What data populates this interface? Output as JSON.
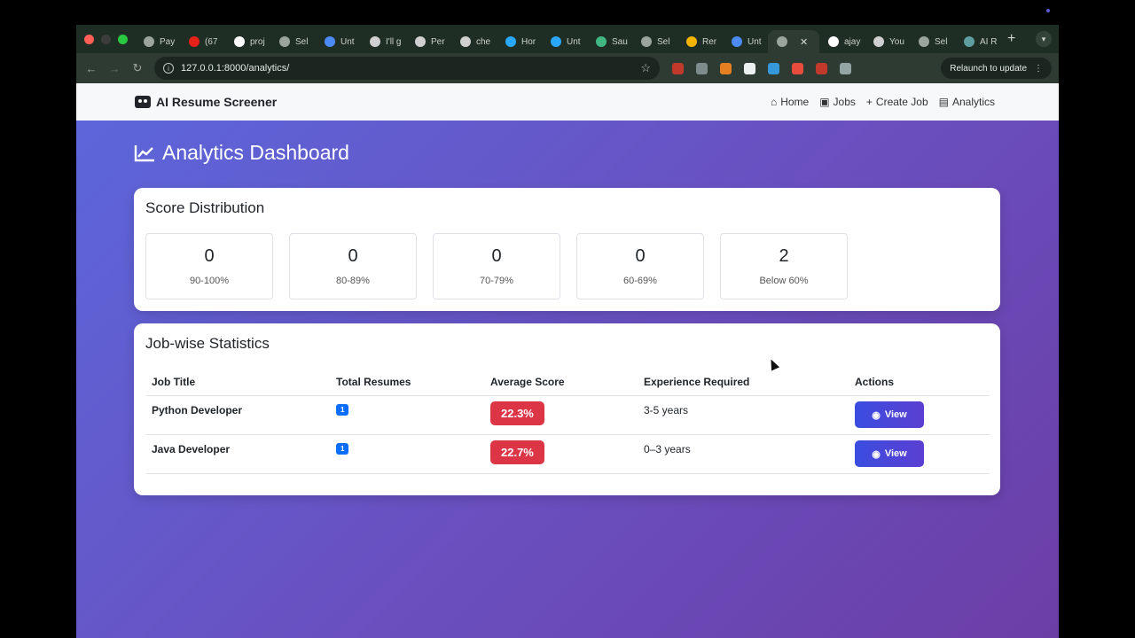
{
  "browser": {
    "tabs": [
      {
        "label": "Pay",
        "icon": "globe-icon",
        "color": "#9aa59d"
      },
      {
        "label": "(67",
        "icon": "youtube-icon",
        "color": "#e62117"
      },
      {
        "label": "proj",
        "icon": "github-icon",
        "color": "#ffffff"
      },
      {
        "label": "Sel",
        "icon": "globe-icon",
        "color": "#9aa59d"
      },
      {
        "label": "Unt",
        "icon": "docs-icon",
        "color": "#4c8bf5"
      },
      {
        "label": "I'll g",
        "icon": "openai-icon",
        "color": "#d0d0d0"
      },
      {
        "label": "Per",
        "icon": "openai-icon",
        "color": "#d0d0d0"
      },
      {
        "label": "che",
        "icon": "openai-icon",
        "color": "#d0d0d0"
      },
      {
        "label": "Hor",
        "icon": "copilot-icon",
        "color": "#2aa7ff"
      },
      {
        "label": "Unt",
        "icon": "copilot-icon",
        "color": "#2aa7ff"
      },
      {
        "label": "Sau",
        "icon": "vue-icon",
        "color": "#41b883"
      },
      {
        "label": "Sel",
        "icon": "globe-icon",
        "color": "#9aa59d"
      },
      {
        "label": "Rer",
        "icon": "slides-icon",
        "color": "#f4b400"
      },
      {
        "label": "Unt",
        "icon": "docs-icon",
        "color": "#4c8bf5"
      },
      {
        "label": "",
        "icon": "globe-icon",
        "color": "#9aa59d",
        "active": true
      },
      {
        "label": "ajay",
        "icon": "github-icon",
        "color": "#ffffff"
      },
      {
        "label": "You",
        "icon": "openai-icon",
        "color": "#d0d0d0"
      },
      {
        "label": "Sel",
        "icon": "globe-icon",
        "color": "#9aa59d"
      },
      {
        "label": "AI R",
        "icon": "globe-icon",
        "color": "#5f9ea0"
      }
    ],
    "url": "127.0.0.1:8000/analytics/",
    "relaunch_label": "Relaunch to update",
    "extensions": [
      "#c0392b",
      "#7f8c8d",
      "#e67e22",
      "#ecf0f1",
      "#3498db",
      "#e74c3c",
      "#c0392b",
      "#95a5a6"
    ]
  },
  "navbar": {
    "brand": "AI Resume Screener",
    "links": [
      {
        "label": "Home",
        "icon": "home-icon"
      },
      {
        "label": "Jobs",
        "icon": "briefcase-icon"
      },
      {
        "label": "Create Job",
        "icon": "plus-icon"
      },
      {
        "label": "Analytics",
        "icon": "chart-bar-icon"
      }
    ]
  },
  "page": {
    "title": "Analytics Dashboard"
  },
  "score_distribution": {
    "title": "Score Distribution",
    "buckets": [
      {
        "count": "0",
        "label": "90-100%"
      },
      {
        "count": "0",
        "label": "80-89%"
      },
      {
        "count": "0",
        "label": "70-79%"
      },
      {
        "count": "0",
        "label": "60-69%"
      },
      {
        "count": "2",
        "label": "Below 60%"
      }
    ]
  },
  "job_stats": {
    "title": "Job-wise Statistics",
    "headers": [
      "Job Title",
      "Total Resumes",
      "Average Score",
      "Experience Required",
      "Actions"
    ],
    "rows": [
      {
        "title": "Python Developer",
        "total": "1",
        "avg": "22.3%",
        "experience": "3-5 years",
        "action": "View"
      },
      {
        "title": "Java Developer",
        "total": "1",
        "avg": "22.7%",
        "experience": "0–3 years",
        "action": "View"
      }
    ]
  },
  "colors": {
    "score_badge": "#dc3545",
    "count_badge": "#0d6efd",
    "gradient_start": "#5b67db",
    "gradient_end": "#6b3ea6"
  }
}
